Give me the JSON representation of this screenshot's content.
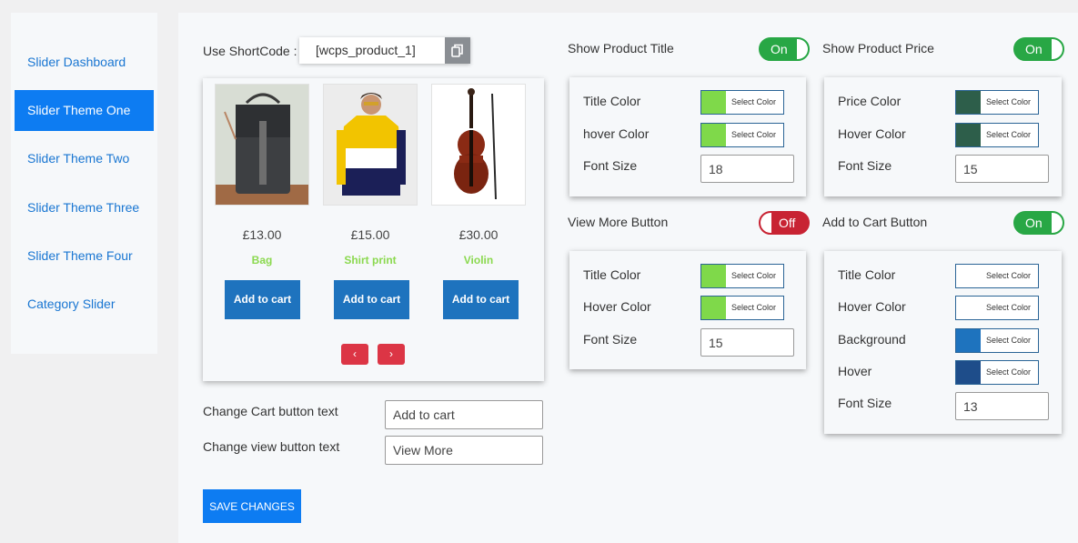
{
  "sidebar": {
    "items": [
      {
        "label": "Slider Dashboard"
      },
      {
        "label": "Slider Theme One"
      },
      {
        "label": "Slider Theme Two"
      },
      {
        "label": "Slider Theme Three"
      },
      {
        "label": "Slider Theme Four"
      },
      {
        "label": "Category Slider"
      }
    ]
  },
  "shortcode": {
    "label": "Use ShortCode :",
    "value": "[wcps_product_1]"
  },
  "preview": {
    "products": [
      {
        "price": "£13.00",
        "name": "Bag",
        "button": "Add to cart"
      },
      {
        "price": "£15.00",
        "name": "Shirt print",
        "button": "Add to cart"
      },
      {
        "price": "£30.00",
        "name": "Violin",
        "button": "Add to cart"
      }
    ],
    "prev": "‹",
    "next": "›"
  },
  "text_settings": {
    "cart_label": "Change Cart button text",
    "cart_value": "Add to cart",
    "view_label": "Change view button text",
    "view_value": "View More"
  },
  "save_label": "SAVE CHANGES",
  "product_title": {
    "label": "Show Product Title",
    "toggle": "On",
    "title_color_label": "Title Color",
    "title_color": "#7fd94a",
    "hover_color_label": "hover Color",
    "hover_color": "#7fd94a",
    "font_size_label": "Font Size",
    "font_size": "18"
  },
  "product_price": {
    "label": "Show Product Price",
    "toggle": "On",
    "price_color_label": "Price Color",
    "price_color": "#2d5e4a",
    "hover_color_label": "Hover Color",
    "hover_color": "#2d5e4a",
    "font_size_label": "Font Size",
    "font_size": "15"
  },
  "view_more": {
    "label": "View More Button",
    "toggle": "Off",
    "title_color_label": "Title Color",
    "title_color": "#7fd94a",
    "hover_color_label": "Hover Color",
    "hover_color": "#7fd94a",
    "font_size_label": "Font Size",
    "font_size": "15"
  },
  "add_to_cart": {
    "label": "Add to Cart Button",
    "toggle": "On",
    "title_color_label": "Title Color",
    "title_color": "#ffffff",
    "hover_color_label": "Hover Color",
    "hover_color": "#ffffff",
    "background_label": "Background",
    "background": "#1e73be",
    "hover_label": "Hover",
    "hover": "#1e4d8a",
    "font_size_label": "Font Size",
    "font_size": "13"
  },
  "select_color_label": "Select Color",
  "colors": {
    "accent": "#0d7cf2",
    "toggle_on": "#28a745",
    "toggle_off": "#c82333",
    "add_button": "#1e73be",
    "arrow": "#dc3545"
  }
}
